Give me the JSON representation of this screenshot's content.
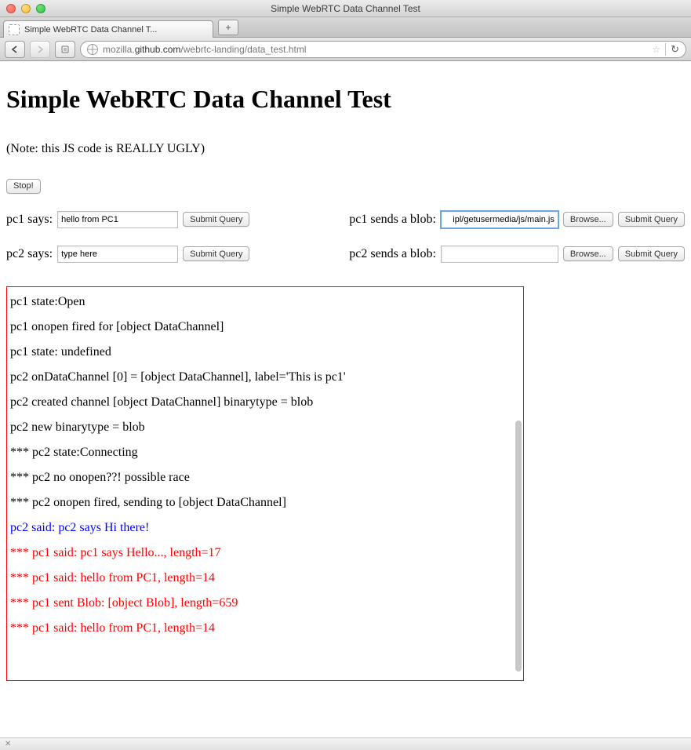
{
  "window": {
    "title": "Simple WebRTC Data Channel Test"
  },
  "tab": {
    "label": "Simple WebRTC Data Channel T..."
  },
  "url": {
    "scheme_and_host_prefix": "mozilla.",
    "host": "github.com",
    "path": "/webrtc-landing/data_test.html"
  },
  "page": {
    "heading": "Simple WebRTC Data Channel Test",
    "note": "(Note: this JS code is REALLY UGLY)",
    "stop_label": "Stop!",
    "submit_label": "Submit Query",
    "browse_label": "Browse...",
    "rows": {
      "pc1": {
        "says_label": "pc1 says:",
        "says_value": "hello from PC1",
        "blob_label": "pc1 sends a blob:",
        "blob_value": "ipl/getusermedia/js/main.js"
      },
      "pc2": {
        "says_label": "pc2 says:",
        "says_value": "type here",
        "blob_label": "pc2 sends a blob:",
        "blob_value": ""
      }
    }
  },
  "log": [
    {
      "text": "pc1 state:Open",
      "class": ""
    },
    {
      "text": "pc1 onopen fired for [object DataChannel]",
      "class": ""
    },
    {
      "text": "pc1 state: undefined",
      "class": ""
    },
    {
      "text": "pc2 onDataChannel [0] = [object DataChannel], label='This is pc1'",
      "class": ""
    },
    {
      "text": "pc2 created channel [object DataChannel] binarytype = blob",
      "class": ""
    },
    {
      "text": "pc2 new binarytype = blob",
      "class": ""
    },
    {
      "text": "*** pc2 state:Connecting",
      "class": ""
    },
    {
      "text": "*** pc2 no onopen??! possible race",
      "class": ""
    },
    {
      "text": "*** pc2 onopen fired, sending to [object DataChannel]",
      "class": ""
    },
    {
      "text": "pc2 said: pc2 says Hi there!",
      "class": "blue"
    },
    {
      "text": "*** pc1 said: pc1 says Hello..., length=17",
      "class": "red"
    },
    {
      "text": "*** pc1 said: hello from PC1, length=14",
      "class": "red"
    },
    {
      "text": "*** pc1 sent Blob: [object Blob], length=659",
      "class": "red"
    },
    {
      "text": "*** pc1 said: hello from PC1, length=14",
      "class": "red"
    }
  ],
  "statusbar": {
    "close_glyph": "✕"
  }
}
